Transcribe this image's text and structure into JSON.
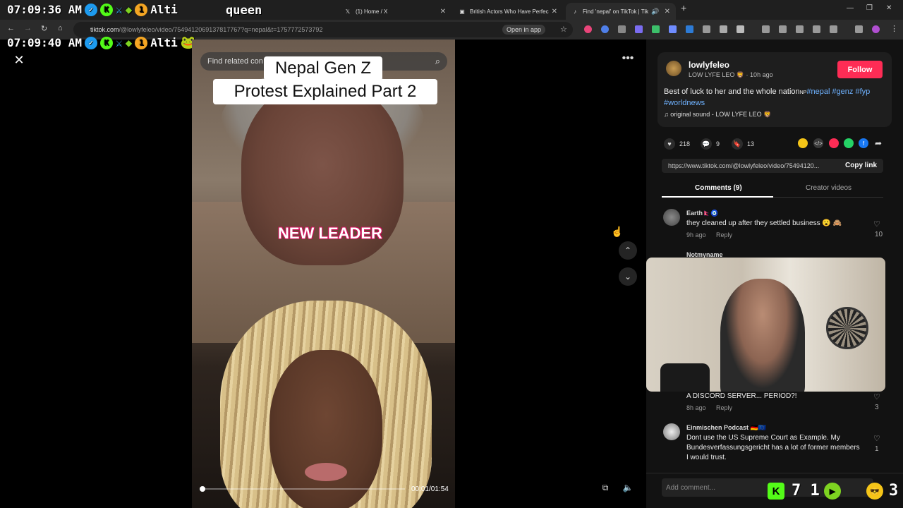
{
  "browser": {
    "tabs": [
      {
        "label": "",
        "closable": true
      },
      {
        "label": "(1) Home / X"
      },
      {
        "label": "British Actors Who Have Perfec"
      },
      {
        "label": "Find 'nepal' on TikTok | Tik"
      }
    ],
    "url_host": "tiktok.com",
    "url_path": "/@lowlyfeleo/video/7549412069137817767?q=nepal&t=1757772573792",
    "open_in_app": "Open in app"
  },
  "overlay": {
    "clock1": "07:09:36 AM",
    "clock2": "07:09:40 AM",
    "alt_label": "Alti",
    "badge_num": "1",
    "queen": "queen",
    "bottom_counts": "7 1",
    "bottom_right": "3"
  },
  "video": {
    "search_placeholder": "Find related con",
    "title_line1": "Nepal Gen Z",
    "title_line2": "Protest Explained Part 2",
    "caption": "NEW LEADER",
    "time": "00:01/01:54",
    "progress_fraction": 0.01
  },
  "post": {
    "author": "lowlyfeleo",
    "author_sub": "LOW LYFE LEO 🦁 · 10h ago",
    "follow_label": "Follow",
    "description": "Best of luck to her and the whole nation",
    "tags": "#nepal #genz #fyp #worldnews",
    "sound": "♫  original sound - LOW LYFE LEO 🦁",
    "likes": "218",
    "comments": "9",
    "saves": "13",
    "link": "https://www.tiktok.com/@lowlyfeleo/video/75494120...",
    "copy_link": "Copy link"
  },
  "panel_tabs": {
    "comments": "Comments (9)",
    "creator": "Creator videos"
  },
  "comments": [
    {
      "name": "Earth🇳🇵🧿",
      "text": "they cleaned up after they settled business 😮 🙈",
      "meta_time": "9h ago",
      "reply": "Reply",
      "likes": "10"
    },
    {
      "name": "Notmyname",
      "text": "A DISCORD SERVER... PERIOD?!",
      "meta_time": "8h ago",
      "reply": "Reply",
      "likes": "3"
    },
    {
      "name": "Einmischen Podcast 🇩🇪🇪🇺",
      "text": "Dont use the US Supreme Court as Example. My Bundesverfassungsgericht has a lot of former members I would trust.",
      "likes": "1"
    }
  ],
  "add_comment_placeholder": "Add comment...",
  "colors": {
    "follow": "#fe2c55",
    "tags": "#6fb2ff",
    "caption_outline": "#d0105a"
  }
}
